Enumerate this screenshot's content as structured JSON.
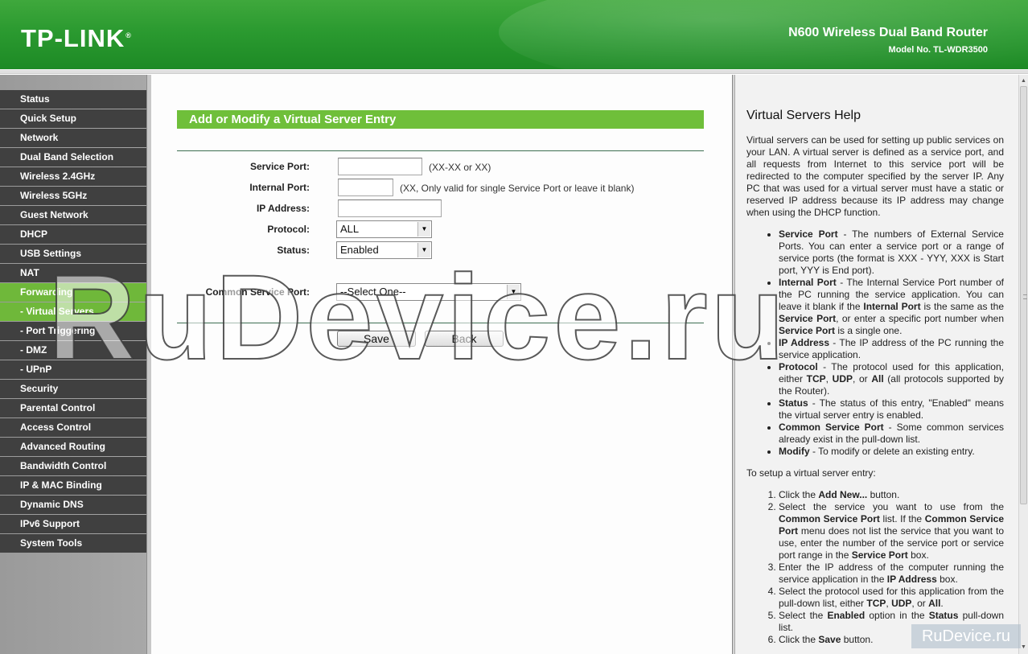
{
  "header": {
    "logo": "TP-LINK",
    "logo_mark": "®",
    "product": "N600 Wireless Dual Band Router",
    "model": "Model No. TL-WDR3500"
  },
  "sidebar": {
    "items": [
      {
        "label": "Status"
      },
      {
        "label": "Quick Setup"
      },
      {
        "label": "Network"
      },
      {
        "label": "Dual Band Selection"
      },
      {
        "label": "Wireless 2.4GHz"
      },
      {
        "label": "Wireless 5GHz"
      },
      {
        "label": "Guest Network"
      },
      {
        "label": "DHCP"
      },
      {
        "label": "USB Settings"
      },
      {
        "label": "NAT"
      },
      {
        "label": "Forwarding"
      },
      {
        "label": "- Virtual Servers"
      },
      {
        "label": "- Port Triggering"
      },
      {
        "label": "- DMZ"
      },
      {
        "label": "- UPnP"
      },
      {
        "label": "Security"
      },
      {
        "label": "Parental Control"
      },
      {
        "label": "Access Control"
      },
      {
        "label": "Advanced Routing"
      },
      {
        "label": "Bandwidth Control"
      },
      {
        "label": "IP & MAC Binding"
      },
      {
        "label": "Dynamic DNS"
      },
      {
        "label": "IPv6 Support"
      },
      {
        "label": "System Tools"
      }
    ],
    "active_item": "Forwarding",
    "active_subitem": "- Virtual Servers"
  },
  "main": {
    "title": "Add or Modify a Virtual Server Entry",
    "service_port": {
      "label": "Service Port:",
      "value": "",
      "hint": "(XX-XX or XX)"
    },
    "internal_port": {
      "label": "Internal Port:",
      "value": "",
      "hint": "(XX, Only valid for single Service Port or leave it blank)"
    },
    "ip_address": {
      "label": "IP Address:",
      "value": ""
    },
    "protocol": {
      "label": "Protocol:",
      "value": "ALL"
    },
    "status": {
      "label": "Status:",
      "value": "Enabled"
    },
    "common_service_port": {
      "label": "Common Service Port:",
      "value": "--Select One--"
    },
    "save_label": "Save",
    "back_label": "Back"
  },
  "help": {
    "title": "Virtual Servers Help",
    "intro": "Virtual servers can be used for setting up public services on your LAN. A virtual server is defined as a service port, and all requests from Internet to this service port will be redirected to the computer specified by the server IP. Any PC that was used for a virtual server must have a static or reserved IP address because its IP address may change when using the DHCP function.",
    "items": {
      "service_port_term": "Service Port",
      "service_port_text": " - The numbers of External Service Ports. You can enter a service port or a range of service ports (the format is XXX - YYY, XXX is Start port, YYY is End port).",
      "internal_port_term": "Internal Port",
      "internal_port_text1": " - The Internal Service Port number of the PC running the service application. You can leave it blank if the ",
      "internal_port_term2": "Internal Port",
      "internal_port_text2": " is the same as the ",
      "internal_port_term3": "Service Port",
      "internal_port_text3": ", or enter a specific port number when ",
      "internal_port_term4": "Service Port",
      "internal_port_text4": " is a single one.",
      "ip_term": "IP Address",
      "ip_text": " - The IP address of the PC running the service application.",
      "protocol_term": "Protocol",
      "protocol_text1": " - The protocol used for this application, either ",
      "protocol_tcp": "TCP",
      "protocol_sep1": ", ",
      "protocol_udp": "UDP",
      "protocol_sep2": ", or ",
      "protocol_all": "All",
      "protocol_text2": " (all protocols supported by the Router).",
      "status_term": "Status",
      "status_text": " - The status of this entry, \"Enabled\" means the virtual server entry is enabled.",
      "csp_term": "Common Service Port",
      "csp_text": " - Some common services already exist in the pull-down list.",
      "modify_term": "Modify",
      "modify_text": " - To modify or delete an existing entry."
    },
    "setup_title": "To setup a virtual server entry:",
    "steps": {
      "s1a": "Click the ",
      "s1b": "Add New...",
      "s1c": " button.",
      "s2a": "Select the service you want to use from the ",
      "s2b": "Common Service Port",
      "s2c": " list. If the ",
      "s2d": "Common Service Port",
      "s2e": " menu does not list the service that you want to use, enter the number of the service port or service port range in the ",
      "s2f": "Service Port",
      "s2g": " box.",
      "s3a": "Enter the IP address of the computer running the service application in the ",
      "s3b": "IP Address",
      "s3c": " box.",
      "s4a": "Select the protocol used for this application from the pull-down list, either ",
      "s4b": "TCP",
      "s4c": ", ",
      "s4d": "UDP",
      "s4e": ", or ",
      "s4f": "All",
      "s4g": ".",
      "s5a": "Select the ",
      "s5b": "Enabled",
      "s5c": " option in the ",
      "s5d": "Status",
      "s5e": " pull-down list.",
      "s6a": "Click the ",
      "s6b": "Save",
      "s6c": " button."
    }
  },
  "watermark": {
    "text": "RuDevice.ru",
    "corner": "RuDevice.ru"
  },
  "colors": {
    "brand_green": "#2b9a30",
    "accent_green": "#6fbf3a",
    "menu_dark": "#404040"
  },
  "icons": {
    "select_arrow": "chevron-down-icon",
    "scroll_up": "arrow-up-icon",
    "scroll_down": "arrow-down-icon"
  }
}
